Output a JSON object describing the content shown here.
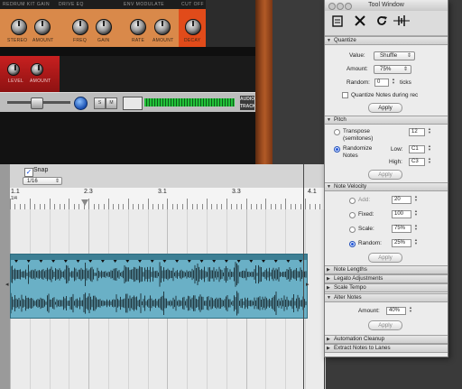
{
  "rack": {
    "modules": [
      {
        "header": "Redrum Kit Gain",
        "knob1": "Stereo",
        "knob2": "Amount",
        "color": "#d9894a"
      },
      {
        "header": "Drive Eq",
        "knob1": "Freq",
        "knob2": "Gain",
        "color": "#d9894a"
      },
      {
        "header": "Env Modulate",
        "knob1": "Rate",
        "knob2": "Amount",
        "color": "#d9894a"
      },
      {
        "header": "Cut Off",
        "knob1": "Decay",
        "knob2": "",
        "color": "#e14b1a"
      }
    ],
    "red_module": {
      "knob1": "Level",
      "knob2": "Amount"
    },
    "audio_track_label": "AUDIO TRACK",
    "track_buttons": [
      "S",
      "M",
      "R"
    ]
  },
  "sequencer": {
    "snap_label": "Snap",
    "snap_checked": "✓",
    "snap_value": "1/16",
    "ruler": {
      "bar_labels": [
        "1.1",
        "2.3",
        "3.1",
        "3.3",
        "4.1"
      ],
      "sub_label": "1/4"
    },
    "clip_color": "#6ab0c6"
  },
  "tool_window": {
    "title": "Tool Window",
    "tools": [
      {
        "name": "clipboard",
        "glyph": "🗒"
      },
      {
        "name": "tools",
        "glyph": "✕"
      },
      {
        "name": "refresh",
        "glyph": "↻"
      },
      {
        "name": "waveform",
        "glyph": "⫶"
      }
    ],
    "quantize": {
      "title": "Quantize",
      "value_label": "Value:",
      "value": "Shuffle",
      "amount_label": "Amount:",
      "amount": "75%",
      "random_label": "Random:",
      "random": "0",
      "random_unit": "ticks",
      "checkbox_label": "Quantize Notes during rec",
      "apply": "Apply"
    },
    "pitch": {
      "title": "Pitch",
      "transpose_label": "Transpose",
      "transpose_sub": "(semitones)",
      "transpose_value": "12",
      "randomize_label": "Randomize",
      "randomize_sub": "Notes",
      "low_label": "Low:",
      "low_value": "C1",
      "high_label": "High:",
      "high_value": "C3",
      "apply": "Apply"
    },
    "note_velocity": {
      "title": "Note Velocity",
      "add_label": "Add:",
      "add_value": "20",
      "fixed_label": "Fixed:",
      "fixed_value": "100",
      "scale_label": "Scale:",
      "scale_value": "75%",
      "random_label": "Random:",
      "random_value": "25%",
      "apply": "Apply"
    },
    "collapsed_1": [
      "Note Lengths",
      "Legato Adjustments",
      "Scale Tempo"
    ],
    "alter_notes": {
      "title": "Alter Notes",
      "amount_label": "Amount:",
      "amount": "40%",
      "apply": "Apply"
    },
    "collapsed_2": [
      "Automation Cleanup",
      "Extract Notes to Lanes"
    ]
  }
}
